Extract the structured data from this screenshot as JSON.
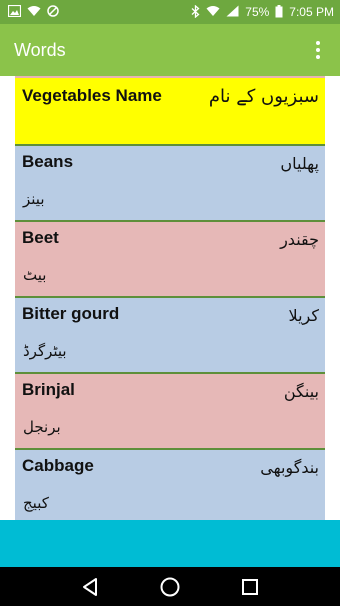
{
  "status_bar": {
    "battery": "75%",
    "time": "7:05 PM"
  },
  "app_bar": {
    "title": "Words"
  },
  "list": {
    "header": {
      "english": "Vegetables Name",
      "urdu": "سبزیوں کے نام"
    },
    "items": [
      {
        "english": "Beans",
        "urdu": "پھلیاں",
        "transliteration": "بینز",
        "color": "#b8cce4"
      },
      {
        "english": "Beet",
        "urdu": "چقندر",
        "transliteration": "بیٹ",
        "color": "#e6b8b7"
      },
      {
        "english": "Bitter gourd",
        "urdu": "کریلا",
        "transliteration": "بیٹرگرڈ",
        "color": "#b8cce4"
      },
      {
        "english": "Brinjal",
        "urdu": "بینگن",
        "transliteration": "برنجل",
        "color": "#e6b8b7"
      },
      {
        "english": "Cabbage",
        "urdu": "بندگوبھی",
        "transliteration": "کبیج",
        "color": "#b8cce4"
      }
    ]
  },
  "colors": {
    "status_bar": "#6ea83f",
    "app_bar": "#8bc34a",
    "header_row": "#ffff00",
    "row_blue": "#b8cce4",
    "row_pink": "#e6b8b7",
    "bottom_bar": "#00bcd4"
  },
  "icons": {
    "status_left": [
      "image-icon",
      "wifi-icon",
      "circle-slash-icon"
    ],
    "status_right": [
      "bluetooth-icon",
      "wifi-icon",
      "signal-icon",
      "battery-icon"
    ],
    "nav": [
      "back-icon",
      "home-icon",
      "recents-icon"
    ]
  }
}
